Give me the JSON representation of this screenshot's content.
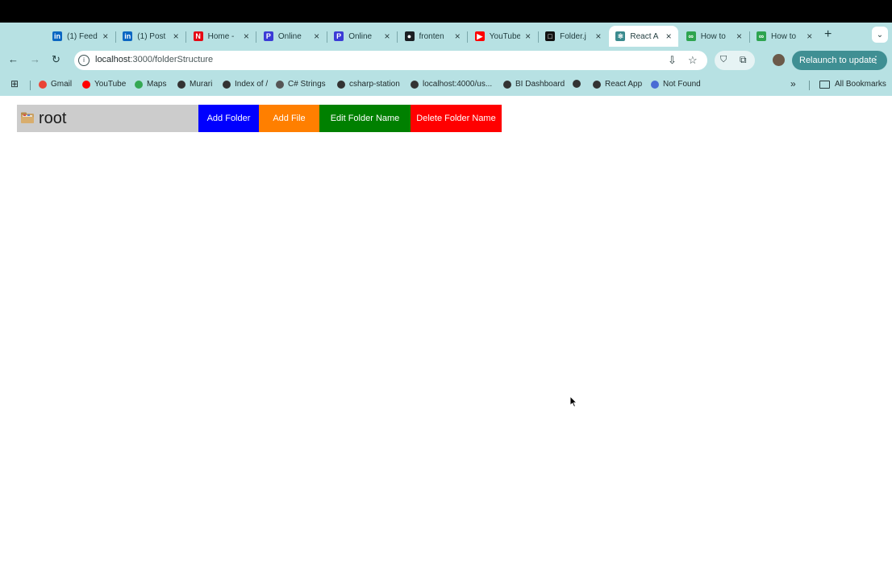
{
  "browser": {
    "tabs": [
      {
        "title": "(1) Feed",
        "icon": "linkedin-icon",
        "color": "#0a66c2",
        "glyph": "in"
      },
      {
        "title": "(1) Post",
        "icon": "linkedin-icon",
        "color": "#0a66c2",
        "glyph": "in"
      },
      {
        "title": "Home -",
        "icon": "netflix-icon",
        "color": "#e50914",
        "glyph": "N"
      },
      {
        "title": "Online",
        "icon": "app-icon",
        "color": "#3b3bd6",
        "glyph": "P"
      },
      {
        "title": "Online",
        "icon": "app-icon",
        "color": "#3b3bd6",
        "glyph": "P"
      },
      {
        "title": "fronten",
        "icon": "github-icon",
        "color": "#1b1f23",
        "glyph": "●"
      },
      {
        "title": "YouTube",
        "icon": "youtube-icon",
        "color": "#ff0000",
        "glyph": "▶"
      },
      {
        "title": "Folder.j",
        "icon": "code-sandbox-icon",
        "color": "#111111",
        "glyph": "□"
      },
      {
        "title": "React A",
        "icon": "react-icon",
        "color": "#3a8a8e",
        "glyph": "⚛"
      },
      {
        "title": "How to",
        "icon": "link-icon",
        "color": "#2ea44f",
        "glyph": "∞"
      },
      {
        "title": "How to",
        "icon": "link-icon",
        "color": "#2ea44f",
        "glyph": "∞"
      }
    ],
    "active_tab_index": 8,
    "url_host": "localhost",
    "url_path": ":3000/folderStructure",
    "relaunch_label": "Relaunch to update",
    "bookmarks": [
      {
        "label": "Gmail",
        "color": "#ea4335"
      },
      {
        "label": "YouTube",
        "color": "#ff0000"
      },
      {
        "label": "Maps",
        "color": "#34a853"
      },
      {
        "label": "Murari",
        "color": "#333333"
      },
      {
        "label": "Index of /",
        "color": "#333333"
      },
      {
        "label": "C# Strings",
        "color": "#555555"
      },
      {
        "label": "csharp-station",
        "color": "#333333"
      },
      {
        "label": "localhost:4000/us...",
        "color": "#333333"
      },
      {
        "label": "BI Dashboard",
        "color": "#333333"
      },
      {
        "label": "",
        "color": "#333333"
      },
      {
        "label": "React App",
        "color": "#333333"
      },
      {
        "label": "Not Found",
        "color": "#4a6cd4"
      }
    ],
    "all_bookmarks_label": "All Bookmarks"
  },
  "app": {
    "root_label": "root",
    "buttons": {
      "add_folder": "Add Folder",
      "add_file": "Add File",
      "edit_folder": "Edit Folder Name",
      "delete_folder": "Delete Folder Name"
    },
    "colors": {
      "add_folder": "#0000ff",
      "add_file": "#ff7f00",
      "edit_folder": "#008000",
      "delete_folder": "#ff0000"
    }
  }
}
